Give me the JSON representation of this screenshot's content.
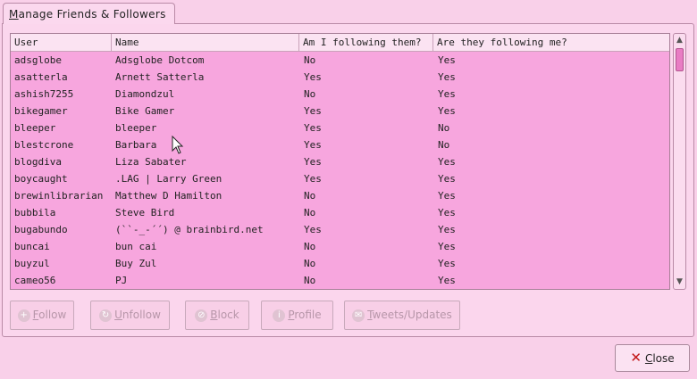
{
  "tab": {
    "mnemonic": "M",
    "rest": "anage Friends & Followers"
  },
  "table": {
    "columns": [
      "User",
      "Name",
      "Am I following them?",
      "Are they following me?"
    ],
    "rows": [
      [
        "adsglobe",
        "Adsglobe Dotcom",
        "No",
        "Yes"
      ],
      [
        "asatterla",
        "Arnett Satterla",
        "Yes",
        "Yes"
      ],
      [
        "ashish7255",
        "Diamondzul",
        "No",
        "Yes"
      ],
      [
        "bikegamer",
        "Bike Gamer",
        "Yes",
        "Yes"
      ],
      [
        "bleeper",
        "bleeper",
        "Yes",
        "No"
      ],
      [
        "blestcrone",
        "Barbara",
        "Yes",
        "No"
      ],
      [
        "blogdiva",
        "Liza Sabater",
        "Yes",
        "Yes"
      ],
      [
        "boycaught",
        ".LAG | Larry Green",
        "Yes",
        "Yes"
      ],
      [
        "brewinlibrarian",
        "Matthew D Hamilton",
        "No",
        "Yes"
      ],
      [
        "bubbila",
        "Steve Bird",
        "No",
        "Yes"
      ],
      [
        "bugabundo",
        "(``-_-´´) @ brainbird.net",
        "Yes",
        "Yes"
      ],
      [
        "buncai",
        "bun cai",
        "No",
        "Yes"
      ],
      [
        "buyzul",
        "Buy Zul",
        "No",
        "Yes"
      ],
      [
        "cameo56",
        "PJ",
        "No",
        "Yes"
      ]
    ]
  },
  "buttons": {
    "follow": {
      "mnemonic": "F",
      "rest": "ollow",
      "icon": "plus-icon"
    },
    "unfollow": {
      "mnemonic": "U",
      "rest": "nfollow",
      "icon": "refresh-icon"
    },
    "block": {
      "mnemonic": "B",
      "rest": "lock",
      "icon": "block-icon"
    },
    "profile": {
      "mnemonic": "P",
      "rest": "rofile",
      "icon": "info-icon"
    },
    "tweets": {
      "mnemonic": "T",
      "rest": "weets/Updates",
      "icon": "tweets-icon"
    },
    "close": {
      "mnemonic": "C",
      "rest": "lose",
      "icon": "close-icon"
    }
  },
  "colors": {
    "background": "#f9d0e9",
    "list_background": "#f7a6de",
    "close_icon": "#c21717"
  }
}
